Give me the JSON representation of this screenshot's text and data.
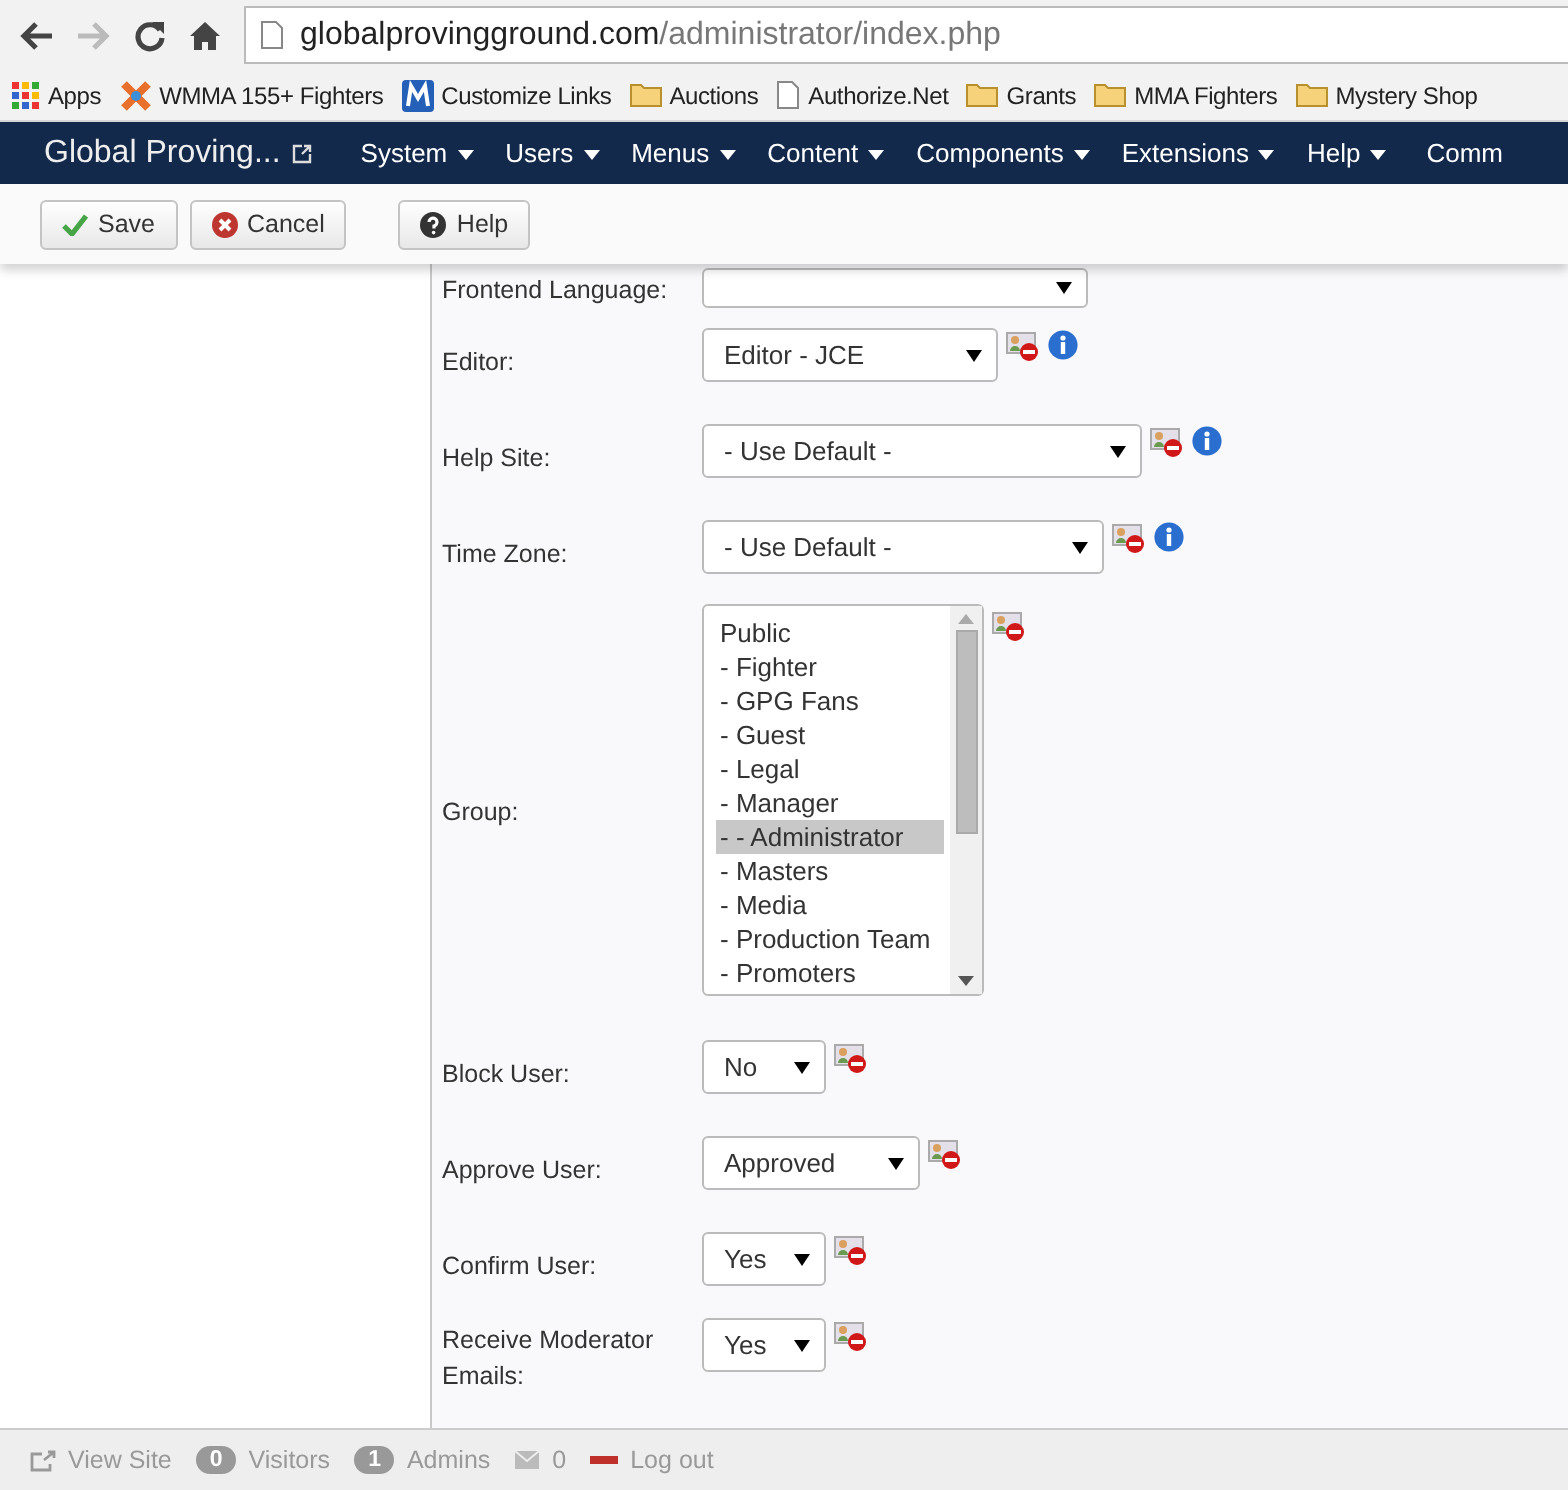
{
  "browser": {
    "nav_buttons": [
      {
        "kind": "back",
        "disabled": false
      },
      {
        "kind": "forward",
        "disabled": true
      },
      {
        "kind": "reload",
        "disabled": false
      },
      {
        "kind": "home",
        "disabled": false
      }
    ],
    "url": {
      "host": "globalprovingground.com",
      "path": "/administrator/index.php"
    },
    "bookmarks": [
      {
        "label": "Apps",
        "kind": "apps"
      },
      {
        "label": "WMMA 155+ Fighters",
        "kind": "x-logo"
      },
      {
        "label": "Customize Links",
        "kind": "m-logo"
      },
      {
        "label": "Auctions",
        "kind": "folder"
      },
      {
        "label": "Authorize.Net",
        "kind": "page"
      },
      {
        "label": "Grants",
        "kind": "folder"
      },
      {
        "label": "MMA Fighters",
        "kind": "folder"
      },
      {
        "label": "Mystery Shop",
        "kind": "folder"
      }
    ]
  },
  "navbar": {
    "brand": "Global Proving...",
    "menus": [
      {
        "label": "System",
        "dropdown": true
      },
      {
        "label": "Users",
        "dropdown": true
      },
      {
        "label": "Menus",
        "dropdown": true
      },
      {
        "label": "Content",
        "dropdown": true
      },
      {
        "label": "Components",
        "dropdown": true
      },
      {
        "label": "Extensions",
        "dropdown": true
      },
      {
        "label": "Help",
        "dropdown": true
      },
      {
        "label": "Comm",
        "dropdown": false
      }
    ]
  },
  "toolbar": [
    {
      "label": "Save",
      "kind": "check"
    },
    {
      "label": "Cancel",
      "kind": "cancel"
    },
    {
      "label": "Help",
      "kind": "help"
    }
  ],
  "fields": [
    {
      "label": "Frontend Language:",
      "kind": "select",
      "reset": false,
      "info": false
    },
    {
      "label": "Editor:",
      "kind": "select",
      "value": "Editor - JCE",
      "reset": true,
      "info": true
    },
    {
      "label": "Help Site:",
      "kind": "select",
      "value": "- Use Default -",
      "reset": true,
      "info": true
    },
    {
      "label": "Time Zone:",
      "kind": "select",
      "value": "- Use Default -",
      "reset": true,
      "info": true
    },
    {
      "label": "Group:",
      "kind": "listbox",
      "reset": true,
      "info": false,
      "options": [
        {
          "label": "Public",
          "selected": false
        },
        {
          "label": "- Fighter",
          "selected": false
        },
        {
          "label": "- GPG Fans",
          "selected": false
        },
        {
          "label": "- Guest",
          "selected": false
        },
        {
          "label": "- Legal",
          "selected": false
        },
        {
          "label": "- Manager",
          "selected": false
        },
        {
          "label": "- - Administrator",
          "selected": true
        },
        {
          "label": "- Masters",
          "selected": false
        },
        {
          "label": "- Media",
          "selected": false
        },
        {
          "label": "- Production Team",
          "selected": false
        },
        {
          "label": "- Promoters",
          "selected": false
        }
      ]
    },
    {
      "label": "Block User:",
      "kind": "select",
      "value": "No",
      "reset": true,
      "info": false
    },
    {
      "label": "Approve User:",
      "kind": "select",
      "value": "Approved",
      "reset": true,
      "info": false
    },
    {
      "label": "Confirm User:",
      "kind": "select",
      "value": "Yes",
      "reset": true,
      "info": false
    },
    {
      "label": "Receive Moderator Emails:",
      "kind": "select",
      "value": "Yes",
      "reset": true,
      "info": false
    }
  ],
  "status_bar": {
    "view_site": "View Site",
    "visitors_count": "0",
    "visitors": "Visitors",
    "admins_count": "1",
    "admins": "Admins",
    "messages": "0",
    "logout": "Log out"
  }
}
